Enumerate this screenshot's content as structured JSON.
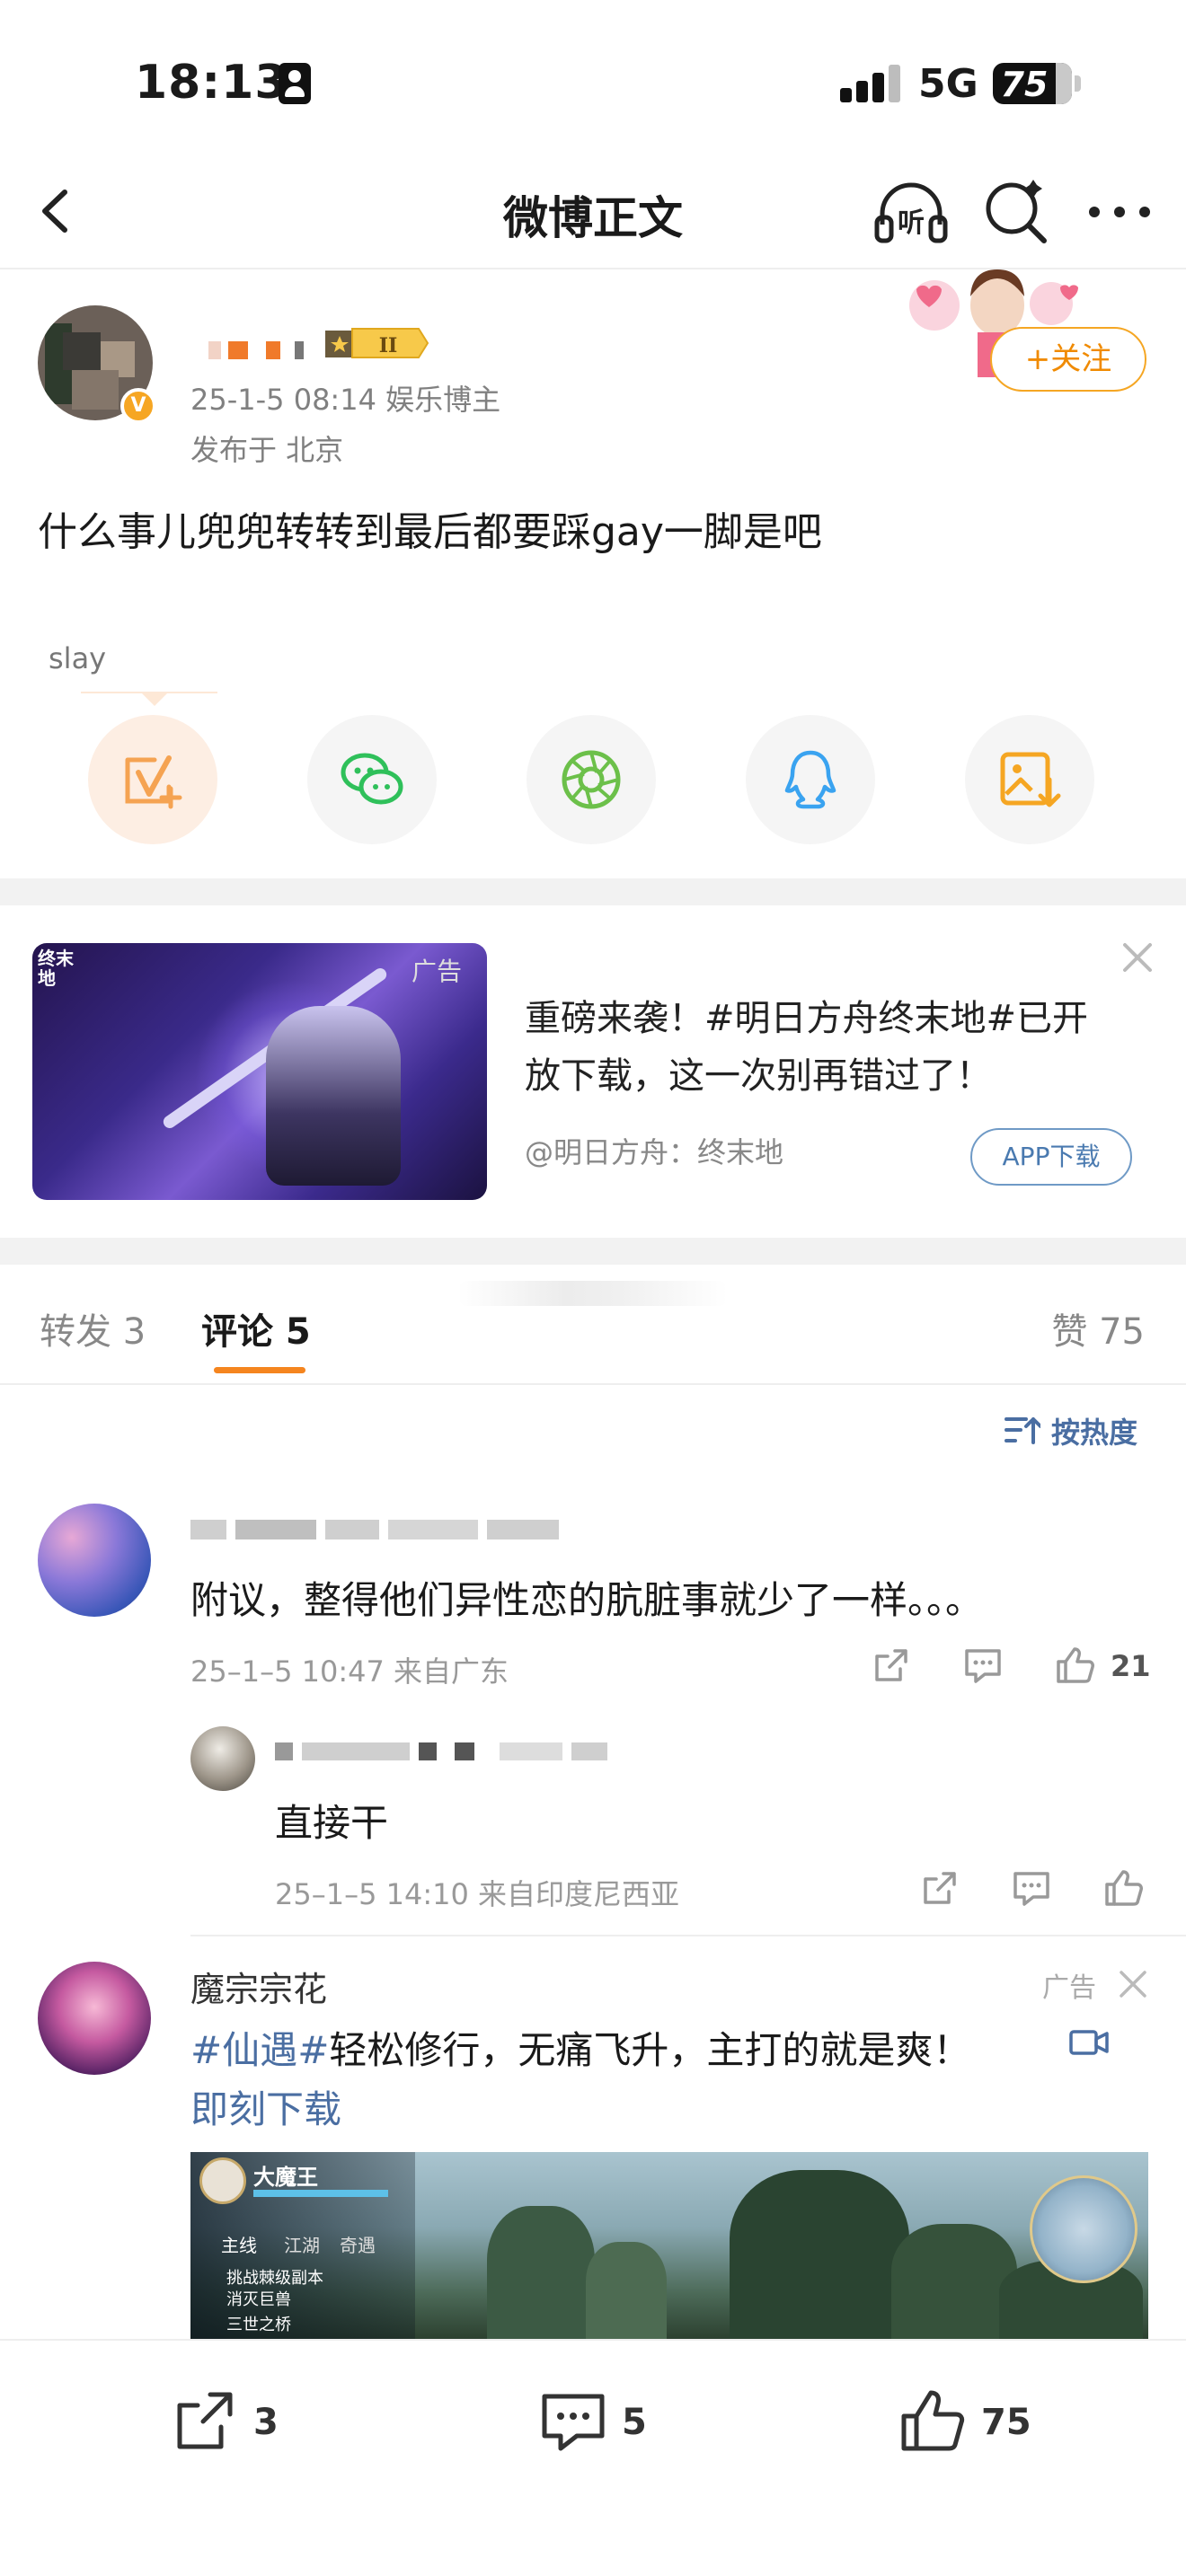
{
  "status_bar": {
    "time": "18:13",
    "network": "5G",
    "battery": "75"
  },
  "nav": {
    "title": "微博正文",
    "listen_label": "听"
  },
  "post": {
    "meta_line": "25-1-5 08:14  娱乐博主",
    "location": "发布于 北京",
    "follow_label": "+关注",
    "text": "什么事儿兜兜转转到最后都要踩gay一脚是吧",
    "tag": "slay"
  },
  "share_buttons": [
    "weibo-forward-icon",
    "wechat-icon",
    "moments-icon",
    "qq-icon",
    "save-image-icon"
  ],
  "ad": {
    "tag": "广告",
    "logo": "终末地",
    "text": "重磅来袭！#明日方舟终末地#已开放下载，这一次别再错过了！",
    "source": "@明日方舟：终末地",
    "button": "APP下载"
  },
  "tabs": {
    "forward": "转发 3",
    "comment": "评论 5",
    "like": "赞 75"
  },
  "sort_label": "按热度",
  "comments": [
    {
      "text": "附议，整得他们异性恋的肮脏事就少了一样。。。",
      "meta": "25–1–5 10:47  来自广东",
      "likes": "21",
      "reply": {
        "text": "直接干",
        "meta": "25–1–5 14:10  来自印度尼西亚"
      }
    }
  ],
  "ad_comment": {
    "name": "魔宗宗花",
    "ad_tag": "广告",
    "hashtag": "#仙遇#",
    "text": "轻松修行，无痛飞升，主打的就是爽！",
    "link": "即刻下载",
    "game": {
      "player_name": "大魔王",
      "tab1": "主线",
      "tab2": "江湖",
      "tab3": "奇遇",
      "quest1": "挑战棘级副本",
      "quest2": "消灭巨兽",
      "quest3": "三世之桥"
    }
  },
  "bottom_bar": {
    "forward_count": "3",
    "comment_count": "5",
    "like_count": "75"
  },
  "colors": {
    "accent": "#f5851f",
    "link": "#4a6ea2",
    "follow": "#f08a00"
  }
}
